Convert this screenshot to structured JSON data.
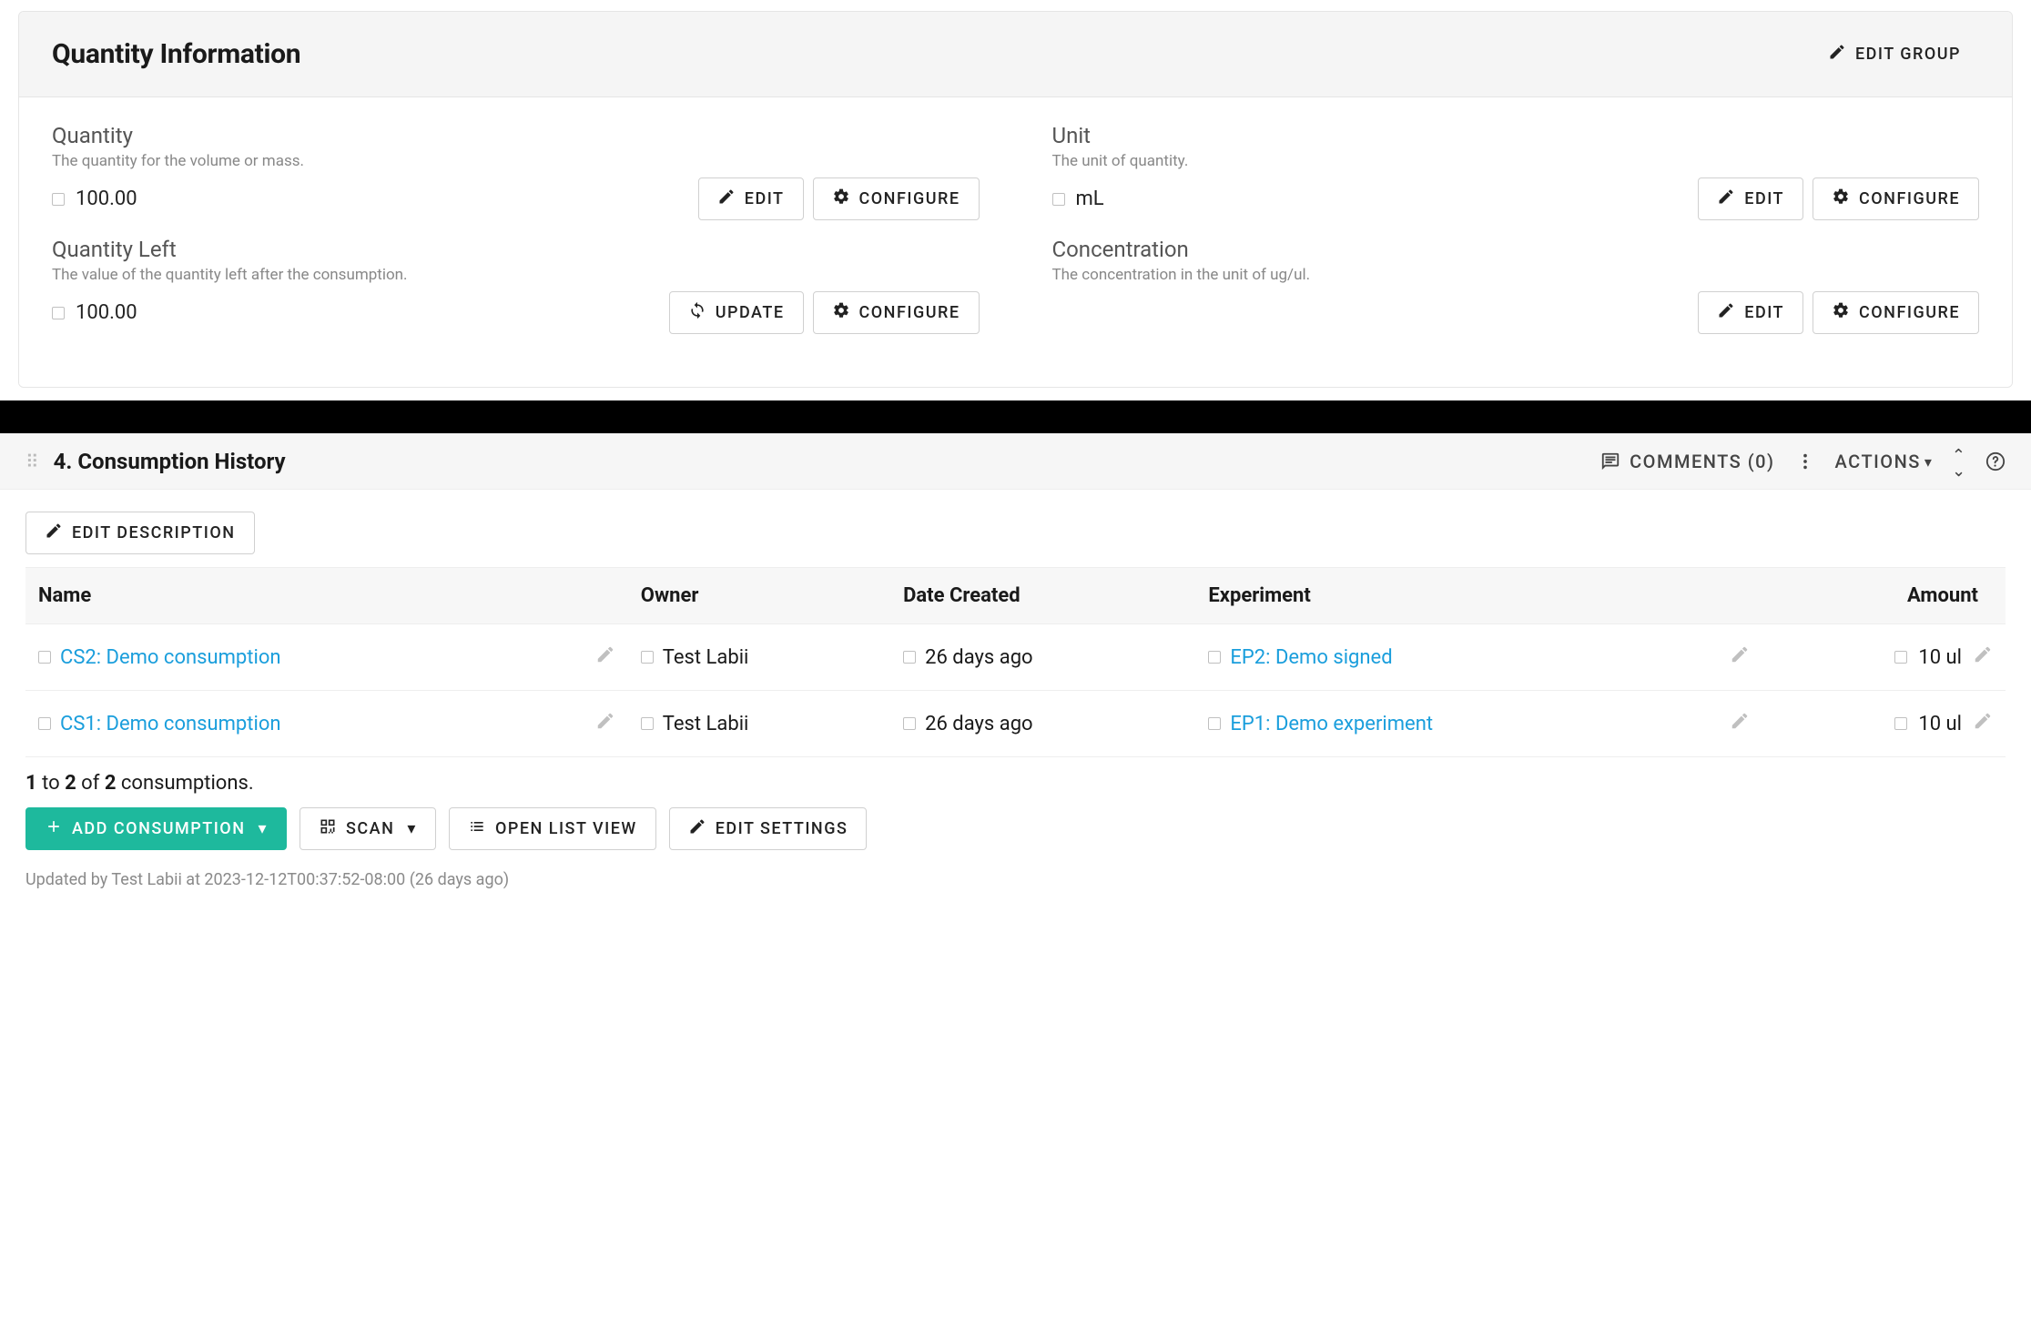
{
  "card": {
    "title": "Quantity Information",
    "edit_group_label": "EDIT GROUP"
  },
  "labels": {
    "edit": "EDIT",
    "configure": "CONFIGURE",
    "update": "UPDATE"
  },
  "fields": {
    "quantity": {
      "label": "Quantity",
      "desc": "The quantity for the volume or mass.",
      "value": "100.00"
    },
    "unit": {
      "label": "Unit",
      "desc": "The unit of quantity.",
      "value": "mL"
    },
    "quantity_left": {
      "label": "Quantity Left",
      "desc": "The value of the quantity left after the consumption.",
      "value": "100.00"
    },
    "concentration": {
      "label": "Concentration",
      "desc": "The concentration in the unit of ug/ul.",
      "value": ""
    }
  },
  "section": {
    "title": "4. Consumption History",
    "comments": "COMMENTS (0)",
    "actions": "ACTIONS",
    "edit_description": "EDIT DESCRIPTION"
  },
  "table": {
    "headers": {
      "name": "Name",
      "owner": "Owner",
      "date": "Date Created",
      "experiment": "Experiment",
      "amount": "Amount"
    },
    "rows": [
      {
        "name": "CS2: Demo consumption",
        "owner": "Test Labii",
        "date": "26 days ago",
        "experiment": "EP2: Demo signed",
        "amount": "10 ul"
      },
      {
        "name": "CS1: Demo consumption",
        "owner": "Test Labii",
        "date": "26 days ago",
        "experiment": "EP1: Demo experiment",
        "amount": "10 ul"
      }
    ]
  },
  "pager": {
    "from": "1",
    "to": "2",
    "total": "2",
    "noun": "consumptions."
  },
  "buttons": {
    "add": "ADD CONSUMPTION",
    "scan": "SCAN",
    "open_list": "OPEN LIST VIEW",
    "edit_settings": "EDIT SETTINGS"
  },
  "footer": {
    "updated": "Updated by Test Labii at 2023-12-12T00:37:52-08:00 (26 days ago)"
  }
}
